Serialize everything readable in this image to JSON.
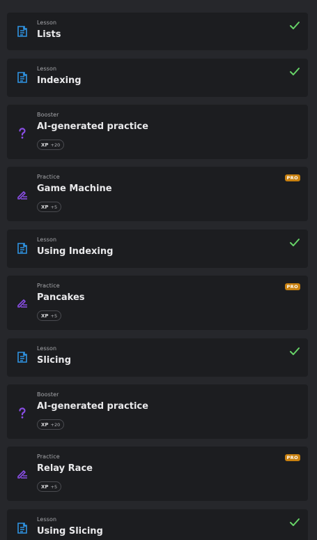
{
  "colors": {
    "lesson_icon": "#2f94e3",
    "booster_icon": "#8a4ee6",
    "practice_icon": "#8a4ee6",
    "check": "#67d468",
    "pro_badge": "#c8800f"
  },
  "items": [
    {
      "kind": "Lesson",
      "title": "Lists",
      "icon": "document-icon",
      "status": "completed-check"
    },
    {
      "kind": "Lesson",
      "title": "Indexing",
      "icon": "document-icon",
      "status": "completed-check"
    },
    {
      "kind": "Booster",
      "title": "AI-generated practice",
      "icon": "question-mark-icon",
      "xp_label": "XP",
      "xp_value": "+20"
    },
    {
      "kind": "Practice",
      "title": "Game Machine",
      "icon": "pencil-lines-icon",
      "badge": "PRO",
      "xp_label": "XP",
      "xp_value": "+5"
    },
    {
      "kind": "Lesson",
      "title": "Using Indexing",
      "icon": "document-icon",
      "status": "completed-check"
    },
    {
      "kind": "Practice",
      "title": "Pancakes",
      "icon": "pencil-lines-icon",
      "badge": "PRO",
      "xp_label": "XP",
      "xp_value": "+5"
    },
    {
      "kind": "Lesson",
      "title": "Slicing",
      "icon": "document-icon",
      "status": "completed-check"
    },
    {
      "kind": "Booster",
      "title": "AI-generated practice",
      "icon": "question-mark-icon",
      "xp_label": "XP",
      "xp_value": "+20"
    },
    {
      "kind": "Practice",
      "title": "Relay Race",
      "icon": "pencil-lines-icon",
      "badge": "PRO",
      "xp_label": "XP",
      "xp_value": "+5"
    },
    {
      "kind": "Lesson",
      "title": "Using Slicing",
      "icon": "document-icon",
      "status": "completed-check"
    }
  ]
}
